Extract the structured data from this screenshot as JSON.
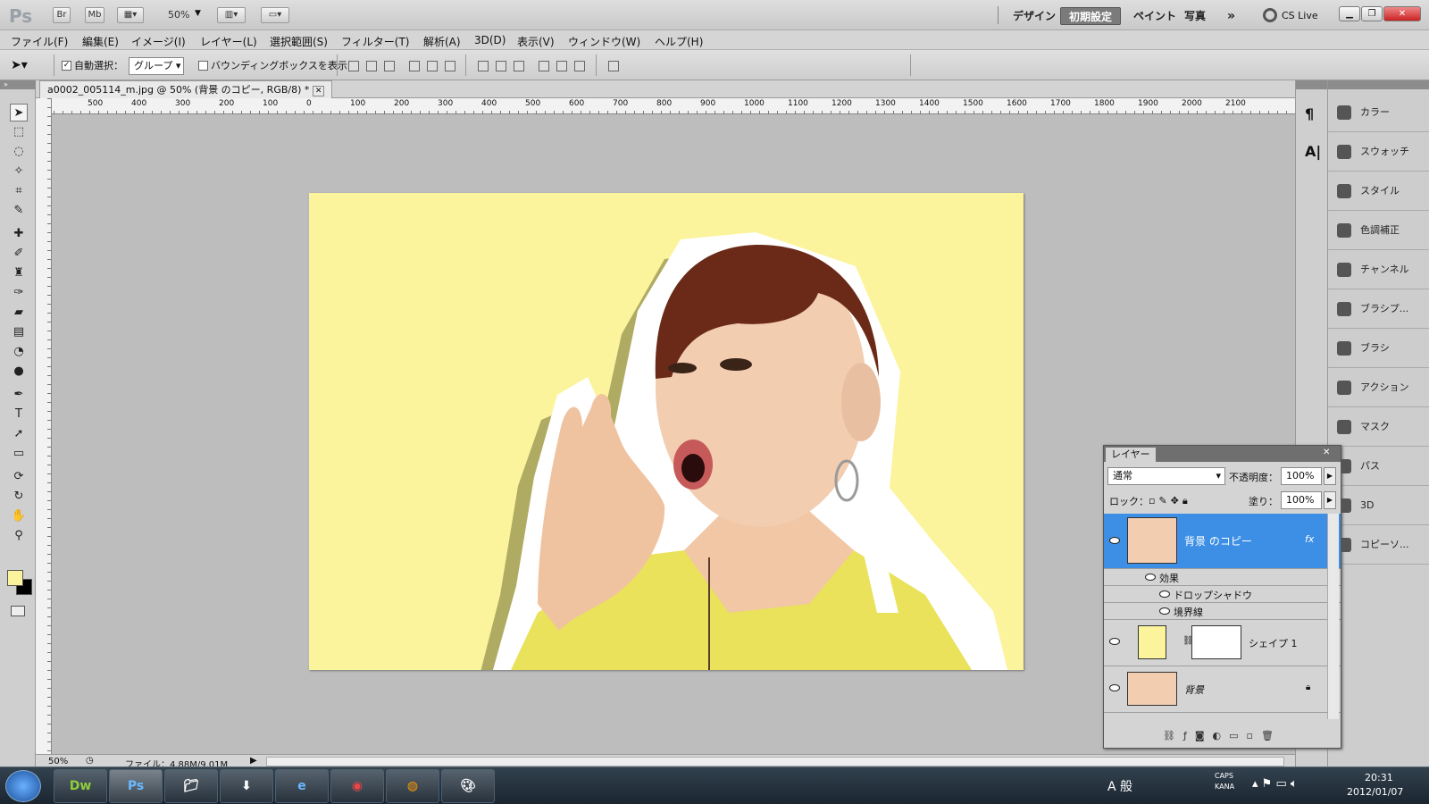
{
  "app": {
    "logo": "Ps",
    "bridge": "Br",
    "minibridge": "Mb",
    "zoom": "50%",
    "workspaces": [
      "デザイン",
      "初期設定",
      "ペイント",
      "写真"
    ],
    "more": "»",
    "cslive": "CS Live"
  },
  "menu": [
    "ファイル(F)",
    "編集(E)",
    "イメージ(I)",
    "レイヤー(L)",
    "選択範囲(S)",
    "フィルター(T)",
    "解析(A)",
    "3D(D)",
    "表示(V)",
    "ウィンドウ(W)",
    "ヘルプ(H)"
  ],
  "options": {
    "auto_select_label": "自動選択：",
    "auto_select_value": "グループ",
    "bounding_box_label": "バウンディングボックスを表示"
  },
  "document": {
    "tab_title": "a0002_005114_m.jpg @ 50% (背景 のコピー, RGB/8) *",
    "status_zoom": "50%",
    "status_file": "ファイル：4.88M/9.01M"
  },
  "ruler": {
    "top_ticks": [
      "500",
      "400",
      "300",
      "200",
      "100",
      "0",
      "100",
      "200",
      "300",
      "400",
      "500",
      "600",
      "700",
      "800",
      "900",
      "1000",
      "1100",
      "1200",
      "1300",
      "1400",
      "1500",
      "1600",
      "1700",
      "1800",
      "1900",
      "2000",
      "2100"
    ]
  },
  "dock": [
    "カラー",
    "スウォッチ",
    "スタイル",
    "色調補正",
    "チャンネル",
    "ブラシプ...",
    "ブラシ",
    "アクション",
    "マスク",
    "パス",
    "3D",
    "コピーソ..."
  ],
  "layers": {
    "tab": "レイヤー",
    "blend": "通常",
    "opacity_label": "不透明度：",
    "opacity": "100%",
    "lock_label": "ロック：",
    "fill_label": "塗り：",
    "fill": "100%",
    "items": [
      {
        "name": "背景 のコピー",
        "fx": "fx"
      },
      {
        "name": "シェイプ 1"
      },
      {
        "name": "背景"
      }
    ],
    "effects_label": "効果",
    "effects": [
      "ドロップシャドウ",
      "境界線"
    ]
  },
  "taskbar": {
    "apps": [
      "Dw",
      "Ps"
    ],
    "ime": "A 般",
    "time": "20:31",
    "date": "2012/01/07",
    "caps": "CAPS",
    "kana": "KANA"
  }
}
